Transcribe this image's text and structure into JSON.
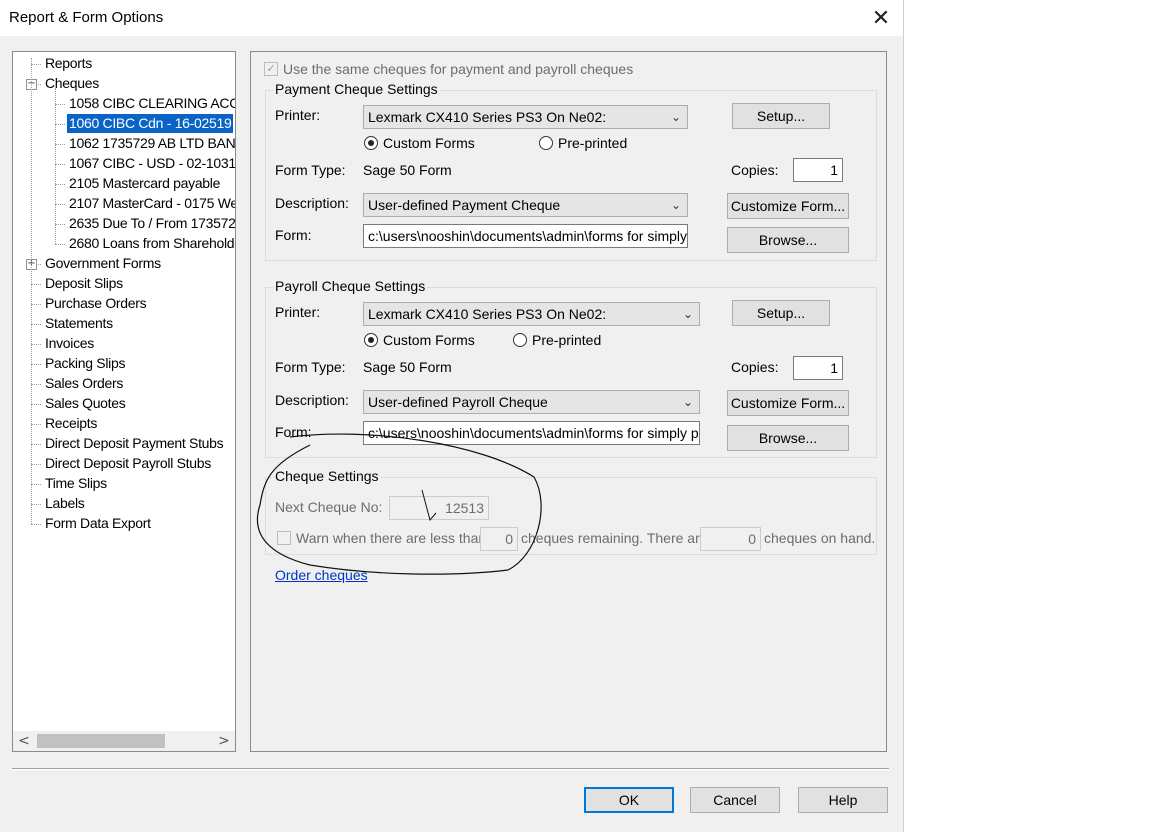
{
  "window": {
    "title": "Report & Form Options",
    "close_glyph": "✕"
  },
  "tree": {
    "items": [
      {
        "label": "Reports",
        "level": 0,
        "expander": ""
      },
      {
        "label": "Cheques",
        "level": 0,
        "expander": "−"
      },
      {
        "label": "1058 CIBC CLEARING ACC",
        "level": 1
      },
      {
        "label": "1060 CIBC Cdn - 16-02519",
        "level": 1,
        "selected": true
      },
      {
        "label": "1062 1735729 AB LTD BAN",
        "level": 1
      },
      {
        "label": "1067 CIBC - USD - 02-1031!",
        "level": 1
      },
      {
        "label": "2105 Mastercard payable",
        "level": 1
      },
      {
        "label": "2107 MasterCard - 0175 We",
        "level": 1
      },
      {
        "label": "2635 Due To / From 173572",
        "level": 1
      },
      {
        "label": "2680 Loans from Shareholde",
        "level": 1
      },
      {
        "label": "Government Forms",
        "level": 0,
        "expander": "+"
      },
      {
        "label": "Deposit Slips",
        "level": 0
      },
      {
        "label": "Purchase Orders",
        "level": 0
      },
      {
        "label": "Statements",
        "level": 0
      },
      {
        "label": "Invoices",
        "level": 0
      },
      {
        "label": "Packing Slips",
        "level": 0
      },
      {
        "label": "Sales Orders",
        "level": 0
      },
      {
        "label": "Sales Quotes",
        "level": 0
      },
      {
        "label": "Receipts",
        "level": 0
      },
      {
        "label": "Direct Deposit Payment Stubs",
        "level": 0
      },
      {
        "label": "Direct Deposit Payroll Stubs",
        "level": 0
      },
      {
        "label": "Time Slips",
        "level": 0
      },
      {
        "label": "Labels",
        "level": 0
      },
      {
        "label": "Form Data Export",
        "level": 0
      }
    ],
    "scroll_left": "<",
    "scroll_right": ">"
  },
  "same_cheques_label": "Use the same cheques for payment and payroll cheques",
  "payment": {
    "group_title": "Payment Cheque Settings",
    "printer_label": "Printer:",
    "printer_value": "Lexmark CX410 Series PS3 On Ne02:",
    "setup_button": "Setup...",
    "custom_forms": "Custom Forms",
    "preprinted": "Pre-printed",
    "form_type_label": "Form Type:",
    "form_type_value": "Sage 50 Form",
    "copies_label": "Copies:",
    "copies_value": "1",
    "description_label": "Description:",
    "description_value": "User-defined Payment Cheque",
    "customize_button": "Customize Form...",
    "form_label": "Form:",
    "form_value": "c:\\users\\nooshin\\documents\\admin\\forms for simply p",
    "browse_button": "Browse..."
  },
  "payroll": {
    "group_title": "Payroll Cheque Settings",
    "printer_label": "Printer:",
    "printer_value": "Lexmark CX410 Series PS3 On Ne02:",
    "setup_button": "Setup...",
    "custom_forms": "Custom Forms",
    "preprinted": "Pre-printed",
    "form_type_label": "Form Type:",
    "form_type_value": "Sage 50 Form",
    "copies_label": "Copies:",
    "copies_value": "1",
    "description_label": "Description:",
    "description_value": "User-defined Payroll Cheque",
    "customize_button": "Customize Form...",
    "form_label": "Form:",
    "form_value": "c:\\users\\nooshin\\documents\\admin\\forms for simply prir",
    "browse_button": "Browse..."
  },
  "cheque_settings": {
    "group_title": "Cheque Settings",
    "next_label": "Next Cheque No:",
    "next_value": "12513",
    "warn_label": "Warn when there are less than",
    "warn_value": "0",
    "remaining_label": "cheques remaining. There are",
    "on_hand_value": "0",
    "on_hand_label": "cheques on hand."
  },
  "order_cheques_link": "Order cheques",
  "buttons": {
    "ok": "OK",
    "cancel": "Cancel",
    "help": "Help"
  },
  "colors": {
    "selection": "#0a64c8",
    "link": "#0033cc",
    "default_button_border": "#0078d7"
  }
}
